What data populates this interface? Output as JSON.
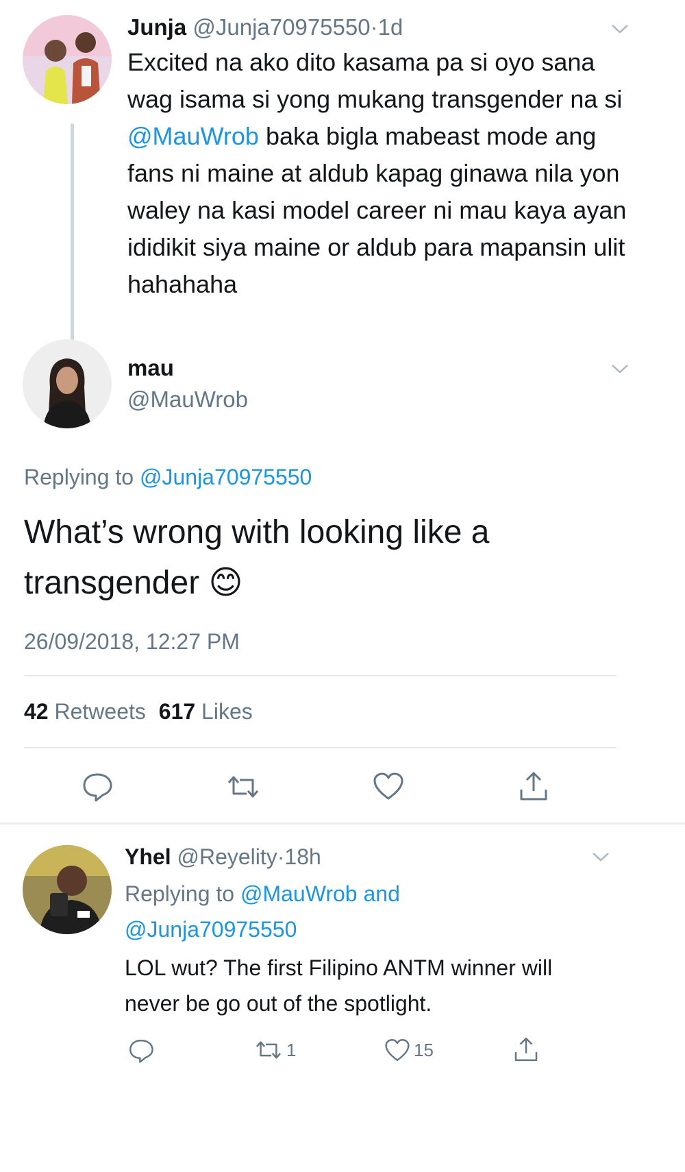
{
  "parent_tweet": {
    "name": "Junja",
    "handle": "@Junja70975550",
    "separator": "·",
    "time": "1d",
    "text_before_mention": "Excited na ako dito kasama pa si oyo sana wag isama si yong mukang transgender na si ",
    "mention": "@MauWrob",
    "text_after_mention": " baka bigla mabeast mode ang fans ni maine at aldub kapag ginawa nila yon waley na kasi model career ni mau kaya ayan ididikit siya maine or aldub para mapansin ulit hahahaha"
  },
  "main_tweet": {
    "name": "mau",
    "handle": "@MauWrob",
    "replying_label": "Replying to",
    "replying_handle": "@Junja70975550",
    "text": "What’s wrong with looking like a transgender",
    "emoji": "😊",
    "timestamp": "26/09/2018, 12:27 PM",
    "retweets_count": "42",
    "retweets_label": "Retweets",
    "likes_count": "617",
    "likes_label": "Likes"
  },
  "reply_tweet": {
    "name": "Yhel",
    "handle": "@Reyelity",
    "separator": "·",
    "time": "18h",
    "replying_label": "Replying to",
    "replying_handles": "@MauWrob and @Junja70975550",
    "text": "LOL wut? The first Filipino ANTM winner will never be go out of the spotlight.",
    "retweet_count": "1",
    "like_count": "15"
  },
  "icons": {
    "caret": "chevron-down-icon",
    "reply": "reply-icon",
    "retweet": "retweet-icon",
    "like": "heart-icon",
    "share": "share-icon"
  },
  "colors": {
    "link": "#1b95e0",
    "secondary_text": "#657786",
    "divider": "#e6ecf0",
    "thread_line": "#ccd6dd"
  }
}
